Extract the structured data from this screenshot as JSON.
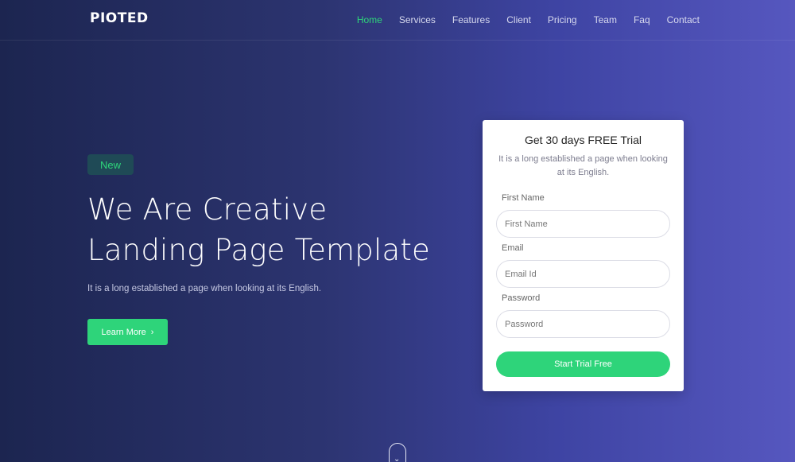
{
  "brand": {
    "logo": "PIOTED"
  },
  "nav": {
    "items": [
      {
        "label": "Home",
        "active": true
      },
      {
        "label": "Services",
        "active": false
      },
      {
        "label": "Features",
        "active": false
      },
      {
        "label": "Client",
        "active": false
      },
      {
        "label": "Pricing",
        "active": false
      },
      {
        "label": "Team",
        "active": false
      },
      {
        "label": "Faq",
        "active": false
      },
      {
        "label": "Contact",
        "active": false
      }
    ],
    "active_color": "#2ed47a"
  },
  "hero": {
    "badge": "New",
    "title_line1": "We Are Creative",
    "title_line2": "Landing Page Template",
    "subtitle": "It is a long established a page when looking at its English.",
    "button_label": "Learn More",
    "button_icon": "chevron-right-icon"
  },
  "trial_form": {
    "title": "Get 30 days FREE Trial",
    "description": "It is a long established a page when looking at its English.",
    "fields": {
      "first_name": {
        "label": "First Name",
        "placeholder": "First Name"
      },
      "email": {
        "label": "Email",
        "placeholder": "Email Id"
      },
      "password": {
        "label": "Password",
        "placeholder": "Password"
      }
    },
    "submit_label": "Start Trial Free"
  },
  "scroll_indicator": {
    "icon": "chevron-down-icon"
  },
  "colors": {
    "accent": "#2ed47a",
    "gradient_start": "#1c2550",
    "gradient_end": "#5657bf"
  }
}
